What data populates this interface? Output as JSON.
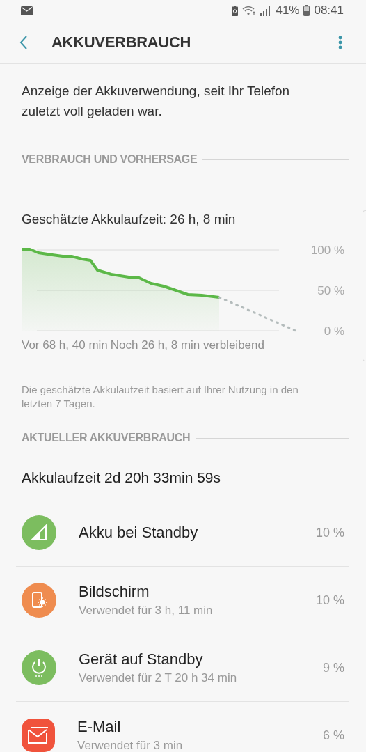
{
  "status_bar": {
    "battery": "41%",
    "time": "08:41"
  },
  "header": {
    "title": "AKKUVERBRAUCH"
  },
  "description": "Anzeige der Akkuverwendung, seit Ihr Telefon zuletzt voll geladen war.",
  "forecast_section": {
    "heading": "VERBRAUCH UND VORHERSAGE",
    "estimate": "Geschätzte Akkulaufzeit: 26 h, 8 min",
    "y_labels": [
      "100 %",
      "50 %",
      "0 %"
    ],
    "start_label": "Vor 68 h, 40 min",
    "end_label": "Noch 26 h, 8 min verbleibend",
    "note": "Die geschätzte Akkulaufzeit basiert auf Ihrer Nutzung in den letzten 7 Tagen."
  },
  "current_section": {
    "heading": "AKTUELLER AKKUVERBRAUCH",
    "runtime": "Akkulaufzeit 2d 20h 33min 59s",
    "items": [
      {
        "kind": "signal",
        "color": "#7cbd5f",
        "name": "Akku bei Standby",
        "percent": "10 %"
      },
      {
        "kind": "screen",
        "color": "#ef8c4f",
        "name": "Bildschirm",
        "detail": "Verwendet für 3 h, 11 min",
        "percent": "10 %"
      },
      {
        "kind": "power",
        "color": "#7cbd5f",
        "name": "Gerät auf Standby",
        "detail": "Verwendet für 2 T 20 h 34 min",
        "percent": "9 %"
      },
      {
        "kind": "email",
        "color": "#f0533c",
        "name": "E-Mail",
        "detail": "Verwendet für 3 min",
        "percent": "6 %"
      }
    ]
  }
}
